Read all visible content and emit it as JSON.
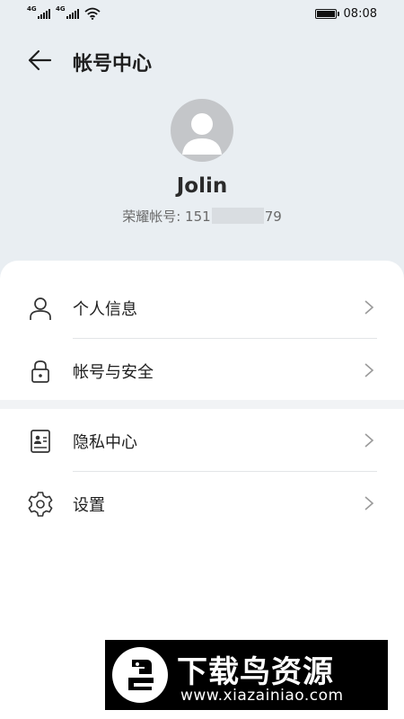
{
  "status_bar": {
    "signal_1_tag": "4G",
    "signal_2_tag": "4G",
    "time": "08:08"
  },
  "header": {
    "title": "帐号中心"
  },
  "profile": {
    "name": "Jolin",
    "account_label": "荣耀帐号: ",
    "account_prefix": "151",
    "account_suffix": "79"
  },
  "menu": {
    "group1": [
      {
        "label": "个人信息",
        "icon": "person-icon"
      },
      {
        "label": "帐号与安全",
        "icon": "lock-icon"
      }
    ],
    "group2": [
      {
        "label": "隐私中心",
        "icon": "privacy-card-icon"
      },
      {
        "label": "设置",
        "icon": "gear-icon"
      }
    ]
  },
  "watermark": {
    "title": "下载鸟资源",
    "url": "www.xiazainiao.com"
  }
}
